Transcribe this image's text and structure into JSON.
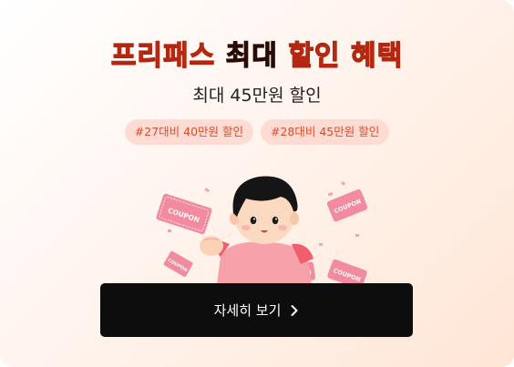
{
  "promo": {
    "headline_part1": "프리패스",
    "headline_part2": "최대",
    "headline_part3": "할인",
    "headline_part4": "혜택",
    "subheadline": "최대 45만원 할인",
    "chips": [
      {
        "label": "#27대비 40만원 할인"
      },
      {
        "label": "#28대비 45만원 할인"
      }
    ],
    "coupon_text": "COUPON",
    "cta_label": "자세히 보기",
    "cta_icon": "chevron-right-icon",
    "colors": {
      "accent": "#e0391b",
      "chip_bg": "#ffdcd3",
      "chip_text": "#e04a2b",
      "button_bg": "#0d0d0d",
      "coupon": "#f28aa0"
    }
  }
}
